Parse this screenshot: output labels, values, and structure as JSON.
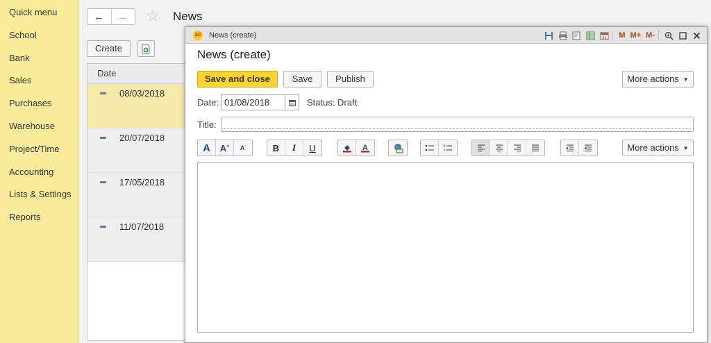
{
  "sidebar": {
    "items": [
      {
        "label": "Quick menu"
      },
      {
        "label": "School"
      },
      {
        "label": "Bank"
      },
      {
        "label": "Sales"
      },
      {
        "label": "Purchases"
      },
      {
        "label": "Warehouse"
      },
      {
        "label": "Project/Time"
      },
      {
        "label": "Accounting"
      },
      {
        "label": "Lists & Settings"
      },
      {
        "label": "Reports"
      }
    ]
  },
  "page": {
    "title": "News",
    "create_label": "Create",
    "list": {
      "header": "Date",
      "rows": [
        {
          "date": "08/03/2018",
          "selected": true
        },
        {
          "date": "20/07/2018",
          "selected": false
        },
        {
          "date": "17/05/2018",
          "selected": false
        },
        {
          "date": "11/07/2018",
          "selected": false
        }
      ]
    }
  },
  "modal": {
    "window_title": "News (create)",
    "heading": "News (create)",
    "toolbar_letters": {
      "m": "M",
      "m_plus": "M+",
      "m_minus": "M-"
    },
    "buttons": {
      "save_and_close": "Save and close",
      "save": "Save",
      "publish": "Publish",
      "more_actions": "More actions"
    },
    "date_label": "Date:",
    "date_value": "01/08/2018",
    "status_label": "Status:",
    "status_value": "Draft",
    "title_label": "Title:",
    "title_value": "",
    "format_more_actions": "More actions",
    "format_letters": {
      "big_a": "A",
      "bold": "B",
      "italic": "I",
      "underline": "U"
    }
  },
  "colors": {
    "sidebar_bg": "#fbec9b",
    "primary_button": "#ffd42e",
    "selected_row": "#f5eaa8"
  }
}
